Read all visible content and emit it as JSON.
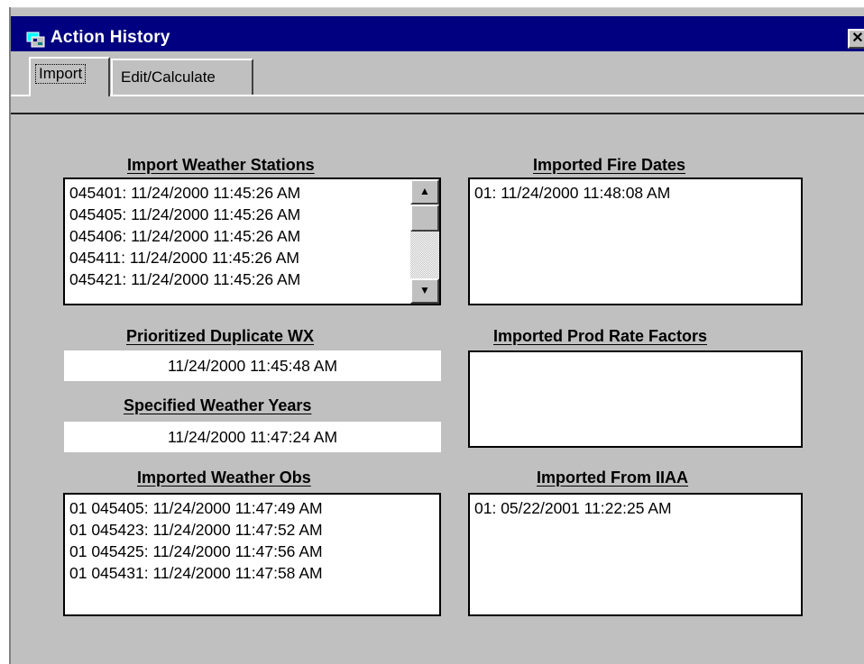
{
  "window": {
    "title": "Action History",
    "close_glyph": "✕"
  },
  "tabs": [
    {
      "label": "Import",
      "selected": true
    },
    {
      "label": "Edit/Calculate",
      "selected": false
    }
  ],
  "import_weather_stations": {
    "heading": "Import Weather Stations",
    "items": [
      "045401: 11/24/2000 11:45:26 AM",
      "045405: 11/24/2000 11:45:26 AM",
      "045406: 11/24/2000 11:45:26 AM",
      "045411: 11/24/2000 11:45:26 AM",
      "045421: 11/24/2000 11:45:26 AM"
    ]
  },
  "imported_fire_dates": {
    "heading": "Imported Fire Dates",
    "items": [
      "01: 11/24/2000 11:48:08 AM"
    ]
  },
  "prioritized_duplicate_wx": {
    "heading": "Prioritized Duplicate WX",
    "value": "11/24/2000 11:45:48 AM"
  },
  "imported_prod_rate_factors": {
    "heading": "Imported Prod Rate Factors",
    "items": []
  },
  "specified_weather_years": {
    "heading": "Specified Weather Years",
    "value": "11/24/2000 11:47:24 AM"
  },
  "imported_weather_obs": {
    "heading": "Imported Weather Obs",
    "items": [
      "01 045405: 11/24/2000 11:47:49 AM",
      "01 045423: 11/24/2000 11:47:52 AM",
      "01 045425: 11/24/2000 11:47:56 AM",
      "01 045431: 11/24/2000 11:47:58 AM"
    ]
  },
  "imported_from_iiaa": {
    "heading": "Imported From IIAA",
    "items": [
      "01: 05/22/2001 11:22:25 AM"
    ]
  },
  "icons": {
    "app": "window-stack-icon",
    "scroll_up": "arrow-up-icon",
    "scroll_down": "arrow-down-icon"
  }
}
